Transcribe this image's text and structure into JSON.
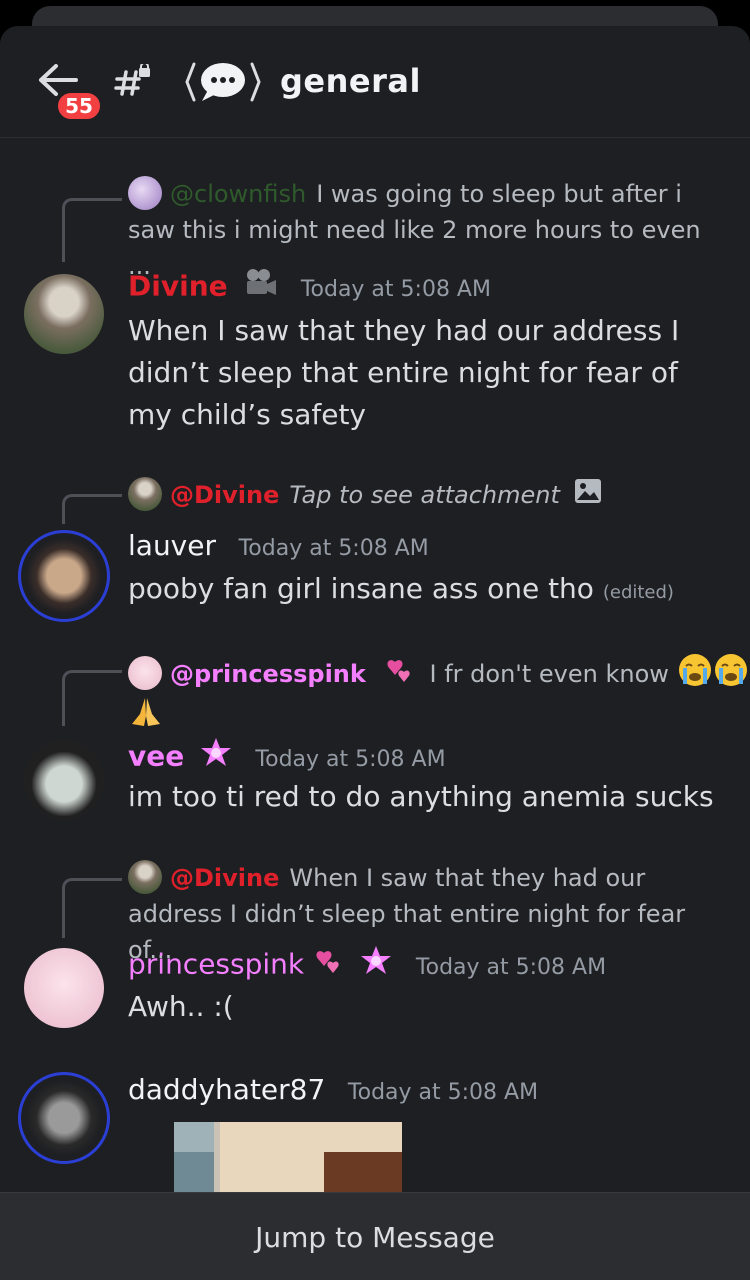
{
  "header": {
    "badge_count": "55",
    "channel_name": "general"
  },
  "messages": [
    {
      "reply": {
        "name": "@clownfish",
        "text": "I was going to sleep but after i saw this i might need like 2 more hours to even ..."
      },
      "author": "Divine",
      "time": "Today at 5:08 AM",
      "body": "When I saw that they had our address I didn’t sleep that entire night for fear of my child’s safety"
    },
    {
      "reply": {
        "name": "@Divine",
        "text": "Tap to see attachment"
      },
      "author": "lauver",
      "time": "Today at 5:08 AM",
      "body": "pooby fan girl insane ass one tho",
      "edited": "(edited)"
    },
    {
      "reply": {
        "name": "@princesspink",
        "text": "I fr don't even know"
      },
      "author": "vee",
      "time": "Today at 5:08 AM",
      "body": "im too  ti red to do anything anemia sucks"
    },
    {
      "reply": {
        "name": "@Divine",
        "text": "When I saw that they had our address I didn’t sleep that entire night for fear of..."
      },
      "author": "princesspink",
      "time": "Today at 5:08 AM",
      "body": "Awh.. :("
    },
    {
      "author": "daddyhater87",
      "time": "Today at 5:08 AM"
    }
  ],
  "jump_label": "Jump to Message",
  "colors": {
    "background": "#1e1f22",
    "divine": "#e0202b",
    "clownfish": "#2f5a2c",
    "pink": "#f47fff",
    "white_name": "#f2f3f5",
    "badge": "#f23f42"
  }
}
